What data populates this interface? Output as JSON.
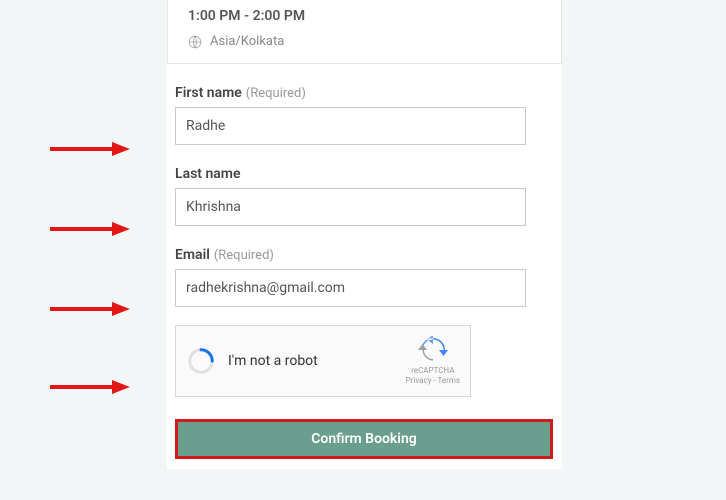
{
  "info": {
    "time_range": "1:00 PM - 2:00 PM",
    "timezone": "Asia/Kolkata"
  },
  "form": {
    "first_name": {
      "label": "First name",
      "required_text": "(Required)",
      "value": "Radhe"
    },
    "last_name": {
      "label": "Last name",
      "value": "Khrishna"
    },
    "email": {
      "label": "Email",
      "required_text": "(Required)",
      "value": "radhekrishna@gmail.com"
    }
  },
  "recaptcha": {
    "label": "I'm not a robot",
    "brand": "reCAPTCHA",
    "legal": "Privacy - Terms"
  },
  "button": {
    "confirm": "Confirm Booking"
  }
}
